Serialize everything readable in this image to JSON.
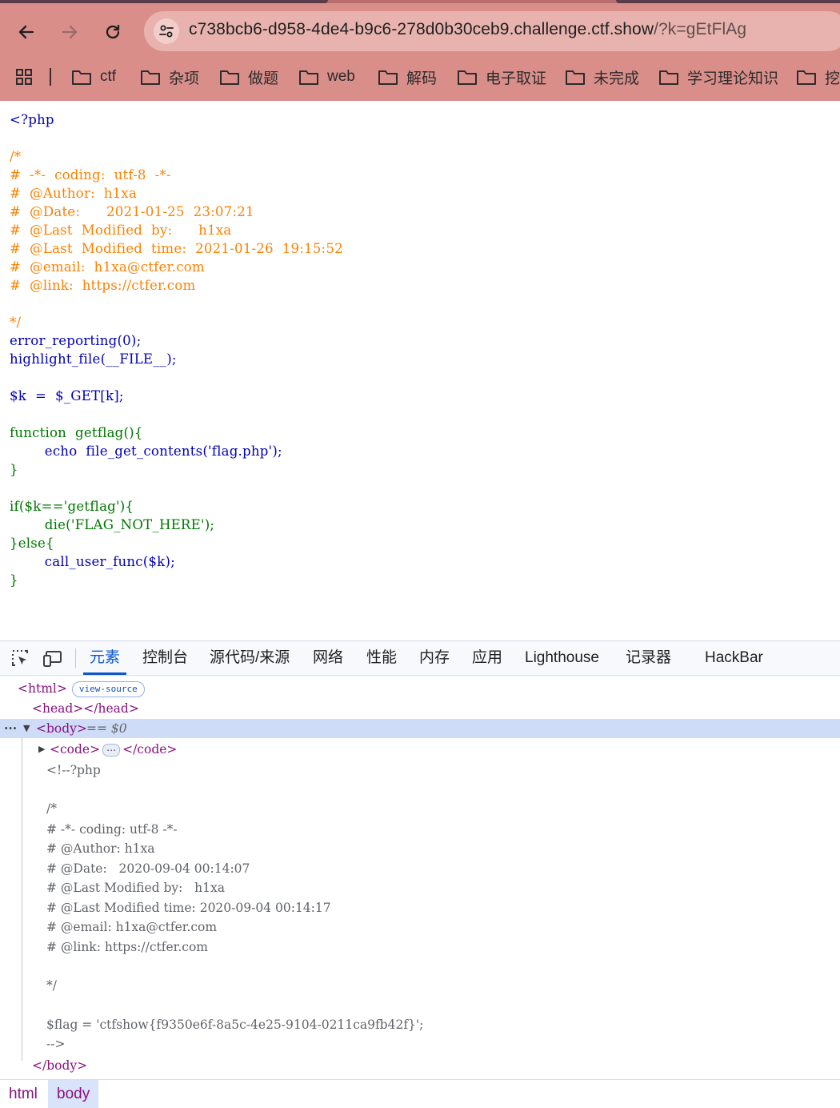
{
  "browser": {
    "url_host": "c738bcb6-d958-4de4-b9c6-278d0b30ceb9.challenge.ctf.show",
    "url_query": "/?k=gEtFlAg",
    "bookmarks": [
      "ctf",
      "杂项",
      "做题",
      "web",
      "解码",
      "电子取证",
      "未完成",
      "学习理论知识",
      "挖"
    ]
  },
  "source": {
    "lines": [
      "<?php",
      "",
      "/*",
      "#  -*-  coding:  utf-8  -*-",
      "#  @Author:  h1xa",
      "#  @Date:      2021-01-25  23:07:21",
      "#  @Last  Modified  by:      h1xa",
      "#  @Last  Modified  time:  2021-01-26  19:15:52",
      "#  @email:  h1xa@ctfer.com",
      "#  @link:  https://ctfer.com",
      "",
      "*/",
      "error_reporting(0);",
      "highlight_file(__FILE__);",
      "",
      "$k  =  $_GET[k];",
      "",
      "function  getflag(){",
      "        echo  file_get_contents('flag.php');",
      "}",
      "",
      "if($k=='getflag'){",
      "        die('FLAG_NOT_HERE');",
      "}else{",
      "        call_user_func($k);",
      "}"
    ]
  },
  "devtools": {
    "tabs": [
      "元素",
      "控制台",
      "源代码/来源",
      "网络",
      "性能",
      "内存",
      "应用",
      "Lighthouse",
      "记录器",
      "HackBar"
    ],
    "active_tab": "元素",
    "dom": {
      "html_open": "<html>",
      "view_source": "view-source",
      "head": "<head></head>",
      "body_open": "<body>",
      "body_marker": "== $0",
      "code_open": "<code>",
      "code_close": "</code>",
      "comment_lines": [
        "<!--?php",
        "",
        "/*",
        "# -*- coding: utf-8 -*-",
        "# @Author: h1xa",
        "# @Date:   2020-09-04 00:14:07",
        "# @Last Modified by:   h1xa",
        "# @Last Modified time: 2020-09-04 00:14:17",
        "# @email: h1xa@ctfer.com",
        "# @link: https://ctfer.com",
        "",
        "*/",
        "",
        "$flag = 'ctfshow{f9350e6f-8a5c-4e25-9104-0211ca9fb42f}';",
        "-->"
      ],
      "body_close": "</body>"
    },
    "breadcrumbs": [
      "html",
      "body"
    ]
  }
}
